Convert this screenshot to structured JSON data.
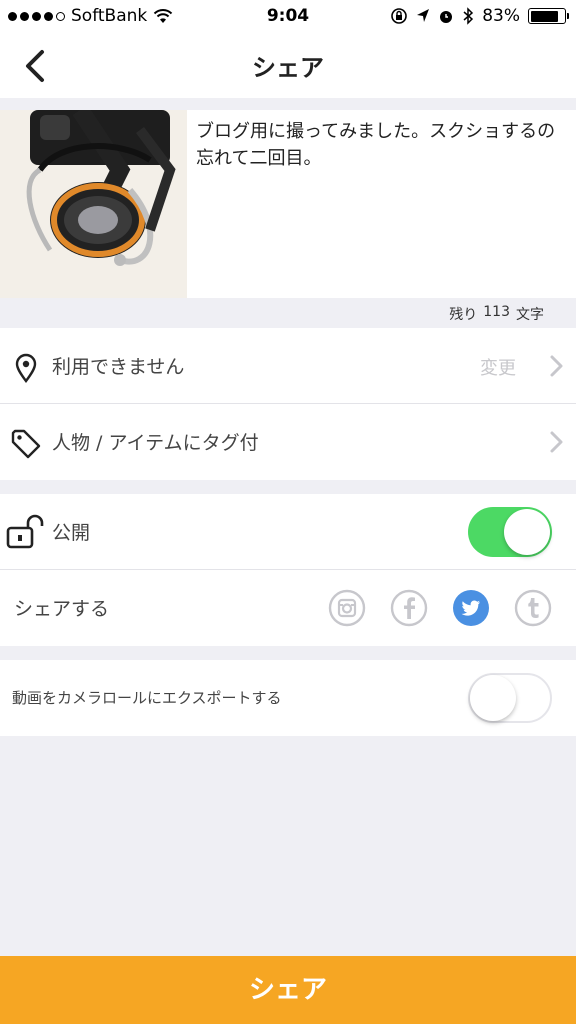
{
  "status_bar": {
    "carrier": "SoftBank",
    "time": "9:04",
    "battery_percent": "83%",
    "battery_level": 0.83,
    "icons": [
      "signal-dots-icon",
      "wifi-icon",
      "orientation-lock-icon",
      "location-icon",
      "alarm-icon",
      "bluetooth-icon",
      "battery-icon"
    ]
  },
  "navbar": {
    "title": "シェア",
    "back_icon": "chevron-left-icon"
  },
  "post": {
    "caption": "ブログ用に撮ってみました。スクショするの忘れて二回目。",
    "thumbnail": "fishing-reel-photo",
    "remaining_label": "残り",
    "remaining_count": "113",
    "remaining_unit": "文字"
  },
  "details": {
    "location_label": "利用できません",
    "location_action": "変更",
    "tag_label": "人物 / アイテムにタグ付"
  },
  "share_options": {
    "public_label": "公開",
    "public_enabled": true,
    "share_label": "シェアする",
    "services": [
      {
        "name": "instagram-icon",
        "color": "#c7c7cc",
        "active": false
      },
      {
        "name": "facebook-icon",
        "color": "#c7c7cc",
        "active": false
      },
      {
        "name": "twitter-icon",
        "color": "#4a90e2",
        "active": true
      },
      {
        "name": "tumblr-icon",
        "color": "#c7c7cc",
        "active": false
      }
    ]
  },
  "export": {
    "label": "動画をカメラロールにエクスポートする",
    "enabled": false
  },
  "footer": {
    "button_label": "シェア",
    "color": "#f6a623"
  },
  "colors": {
    "toggle_on": "#4cd964",
    "accent": "#f6a623",
    "twitter": "#4a90e2"
  }
}
